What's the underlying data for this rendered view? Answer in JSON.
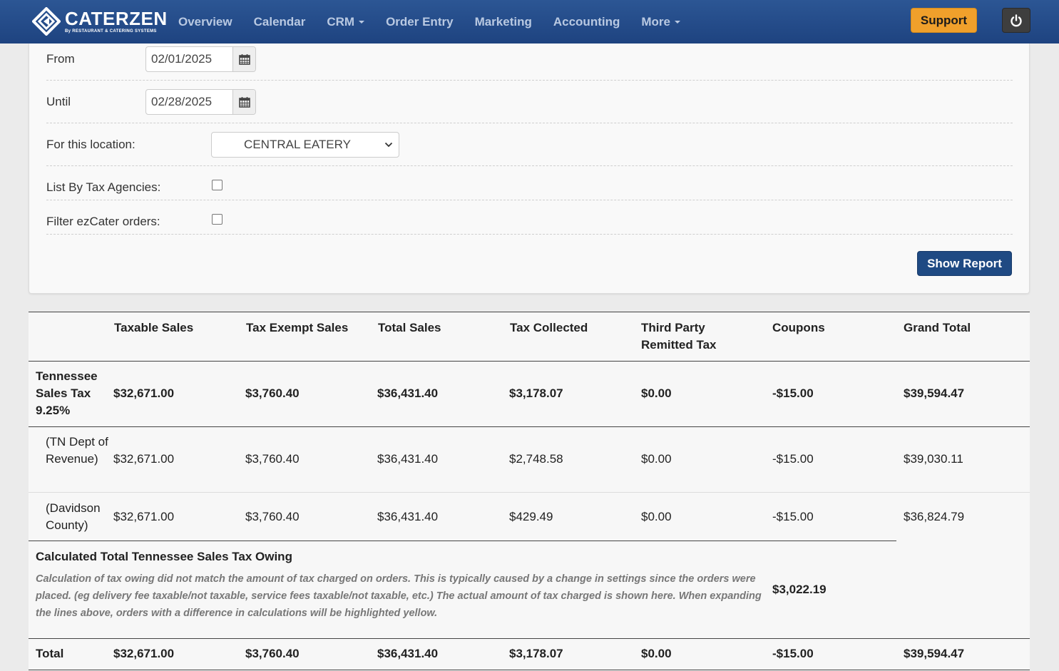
{
  "nav": {
    "brand": "CATERZEN",
    "brand_sub": "By RESTAURANT & CATERING SYSTEMS",
    "items": [
      "Overview",
      "Calendar",
      "CRM",
      "Order Entry",
      "Marketing",
      "Accounting",
      "More"
    ],
    "support_label": "Support"
  },
  "form": {
    "from_label": "From",
    "from_value": "02/01/2025",
    "until_label": "Until",
    "until_value": "02/28/2025",
    "location_label": "For this location:",
    "location_value": "CENTRAL EATERY",
    "tax_agencies_label": "List By Tax Agencies:",
    "tax_agencies_checked": false,
    "ezcater_label": "Filter ezCater orders:",
    "ezcater_checked": false,
    "show_report_label": "Show Report"
  },
  "table": {
    "headers": [
      "",
      "Taxable Sales",
      "Tax Exempt Sales",
      "Total Sales",
      "Tax Collected",
      "Third Party Remitted Tax",
      "Coupons",
      "Grand Total"
    ],
    "rows": [
      {
        "name": "Tennessee Sales Tax 9.25%",
        "bold": true,
        "values": [
          "$32,671.00",
          "$3,760.40",
          "$36,431.40",
          "$3,178.07",
          "$0.00",
          "-$15.00",
          "$39,594.47"
        ]
      },
      {
        "name": "(TN Dept of Revenue)",
        "bold": false,
        "values": [
          "$32,671.00",
          "$3,760.40",
          "$36,431.40",
          "$2,748.58",
          "$0.00",
          "-$15.00",
          "$39,030.11"
        ]
      },
      {
        "name": "(Davidson County)",
        "bold": false,
        "values": [
          "$32,671.00",
          "$3,760.40",
          "$36,431.40",
          "$429.49",
          "$0.00",
          "-$15.00",
          "$36,824.79"
        ]
      }
    ],
    "owing_title": "Calculated Total Tennessee Sales Tax Owing",
    "owing_note": "Calculation of tax owing did not match the amount of tax charged on orders. This is typically caused by a change in settings since the orders were placed. (eg delivery fee taxable/not taxable, service fees taxable/not taxable, etc.) The actual amount of tax charged is shown here. When expanding the lines above, orders with a difference in calculations will be highlighted yellow.",
    "owing_value": "$3,022.19",
    "total": {
      "name": "Total",
      "values": [
        "$32,671.00",
        "$3,760.40",
        "$36,431.40",
        "$3,178.07",
        "$0.00",
        "-$15.00",
        "$39,594.47"
      ]
    }
  }
}
